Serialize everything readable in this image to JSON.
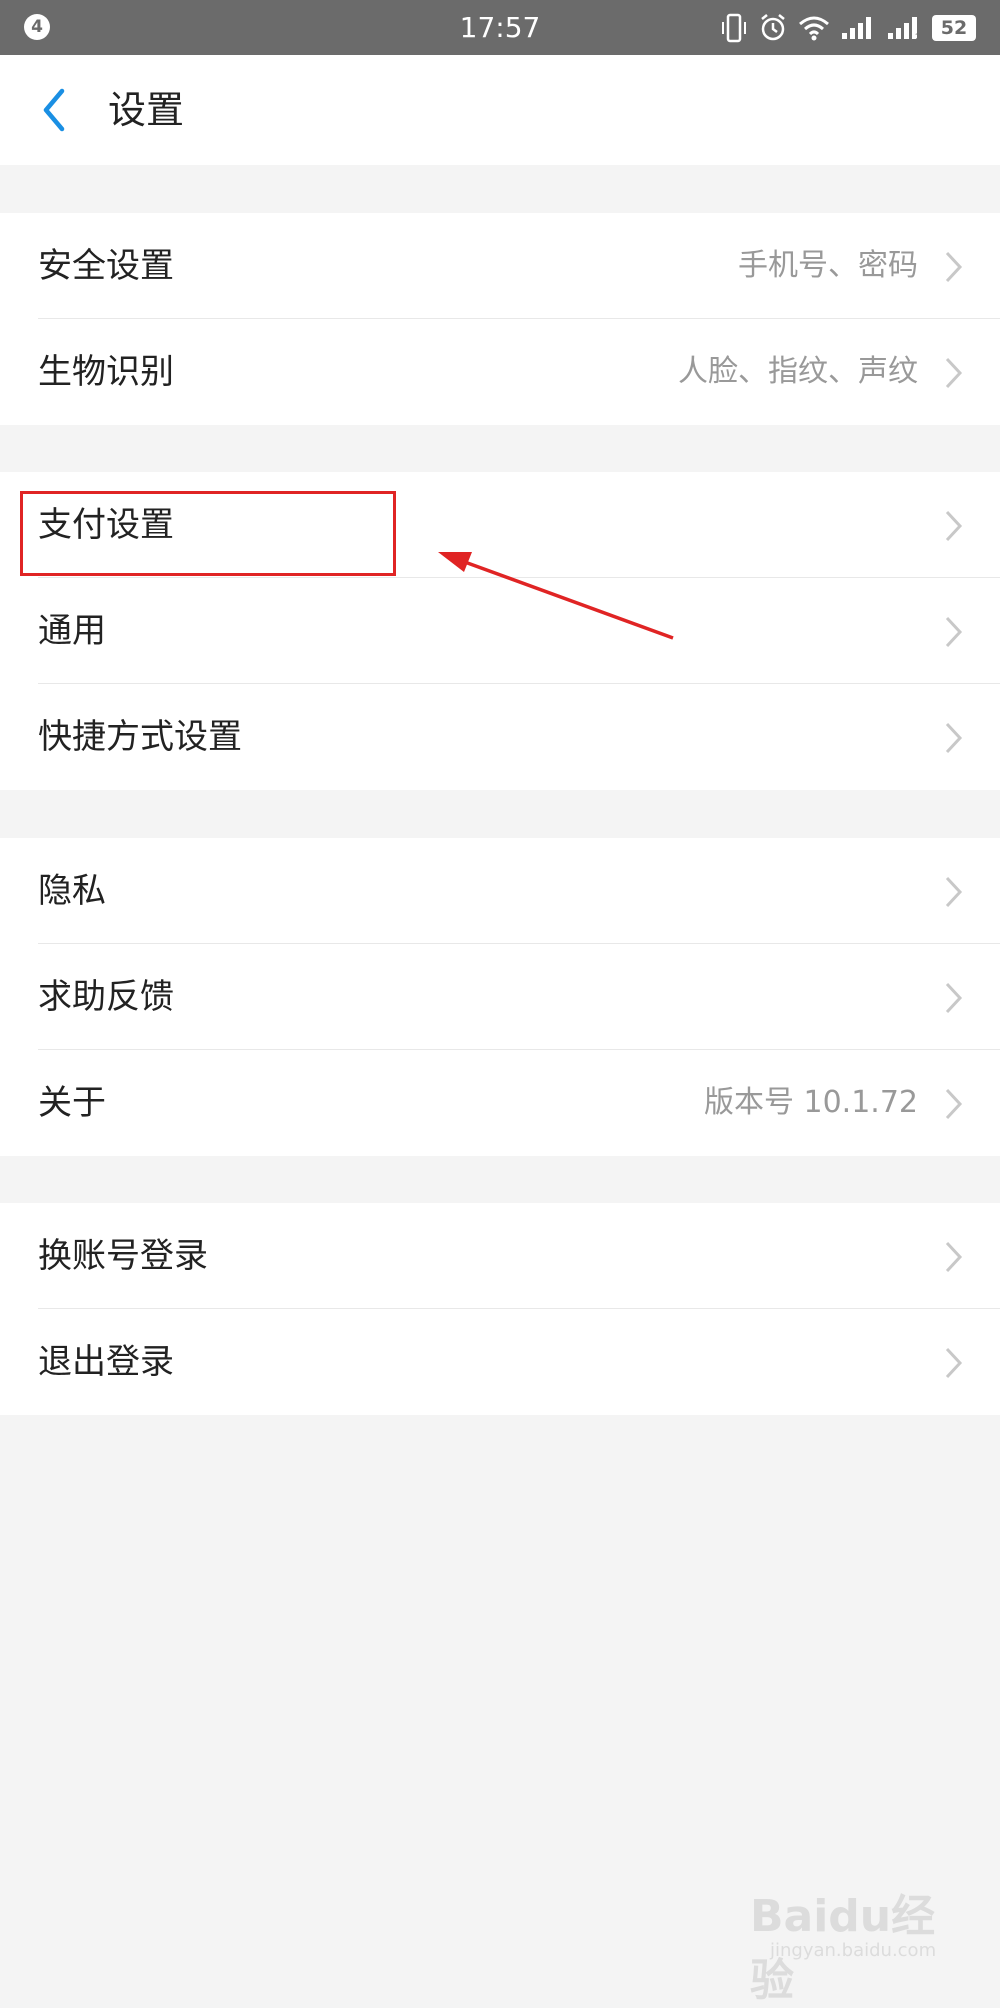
{
  "status_bar": {
    "notification_count": "4",
    "time": "17:57",
    "battery": "52",
    "sim_slot": "2"
  },
  "header": {
    "title": "设置"
  },
  "sections": [
    {
      "rows": [
        {
          "label": "安全设置",
          "value": "手机号、密码"
        },
        {
          "label": "生物识别",
          "value": "人脸、指纹、声纹"
        }
      ]
    },
    {
      "rows": [
        {
          "label": "支付设置",
          "value": ""
        },
        {
          "label": "通用",
          "value": ""
        },
        {
          "label": "快捷方式设置",
          "value": ""
        }
      ]
    },
    {
      "rows": [
        {
          "label": "隐私",
          "value": ""
        },
        {
          "label": "求助反馈",
          "value": ""
        },
        {
          "label": "关于",
          "value": "版本号 10.1.72"
        }
      ]
    },
    {
      "rows": [
        {
          "label": "换账号登录",
          "value": ""
        },
        {
          "label": "退出登录",
          "value": ""
        }
      ]
    }
  ],
  "watermark": {
    "brand": "Baidu经验",
    "domain": "jingyan.baidu.com"
  },
  "colors": {
    "accent": "#1a8fe3",
    "annotation": "#e02424",
    "background": "#f4f4f4",
    "status_bar": "#6b6b6b"
  }
}
